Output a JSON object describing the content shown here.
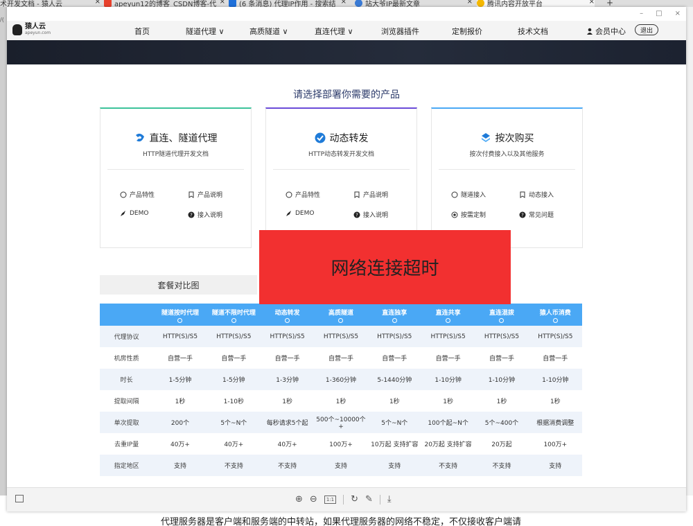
{
  "browser": {
    "tabs": [
      {
        "label": "术开发文档 - 猿人云",
        "active": false
      },
      {
        "label": "apeyun12的博客_CSDN博客-代",
        "active": false,
        "icon_color": "#e8412c"
      },
      {
        "label": "(6 条消息) 代理IP作用 - 搜索结",
        "active": false,
        "icon_color": "#1e6fd9"
      },
      {
        "label": "站大爷IP最新文章",
        "active": false,
        "icon_color": "#3a7bd5"
      },
      {
        "label": "腾讯内容开放平台",
        "active": true,
        "icon_color": "#f5b800"
      }
    ],
    "new_tab": "+",
    "left_stub": "/("
  },
  "window_controls": {
    "minimize": "–",
    "maximize": "□",
    "close": "×"
  },
  "site": {
    "logo": {
      "name": "猿人云",
      "domain": "apeyun.com"
    },
    "nav": [
      "首页",
      "隧道代理 ∨",
      "高质隧道 ∨",
      "直连代理 ∨",
      "浏览器插件",
      "定制报价",
      "技术文档"
    ],
    "user": "会员中心",
    "logout": "退出"
  },
  "section_title": "请选择部署你需要的产品",
  "cards": [
    {
      "title": "直连、隧道代理",
      "subtitle": "HTTP隧道代理开发文档",
      "accent": "#3cc29a",
      "icon": "arrow-logo-icon",
      "items": [
        "产品特性",
        "产品说明",
        "DEMO",
        "接入说明"
      ]
    },
    {
      "title": "动态转发",
      "subtitle": "HTTP动态转发开发文档",
      "accent": "#6a4bd8",
      "icon": "check-circle-icon",
      "items": [
        "产品特性",
        "产品说明",
        "DEMO",
        "接入说明"
      ]
    },
    {
      "title": "按次购买",
      "subtitle": "按次付费接入以及其他服务",
      "accent": "#4aa8f5",
      "icon": "layers-icon",
      "items": [
        "隧道接入",
        "动态接入",
        "按需定制",
        "常见问题"
      ]
    }
  ],
  "compare_tab": "套餐对比图",
  "overlay_message": "网络连接超时",
  "table": {
    "headers": [
      "",
      "隧道按时代理",
      "隧道不限时代理",
      "动态转发",
      "高质隧道",
      "直连独享",
      "直连共享",
      "直连混拨",
      "猿人币消费"
    ],
    "rows": [
      [
        "代理协议",
        "HTTP(S)/S5",
        "HTTP(S)/S5",
        "HTTP(S)/S5",
        "HTTP(S)/S5",
        "HTTP(S)/S5",
        "HTTP(S)/S5",
        "HTTP(S)/S5",
        "HTTP(S)/S5"
      ],
      [
        "机房性质",
        "自营一手",
        "自营一手",
        "自营一手",
        "自营一手",
        "自营一手",
        "自营一手",
        "自营一手",
        "自营一手"
      ],
      [
        "时长",
        "1-5分钟",
        "1-5分钟",
        "1-3分钟",
        "1-360分钟",
        "5-1440分钟",
        "1-10分钟",
        "1-10分钟",
        "1-10分钟"
      ],
      [
        "提取间隔",
        "1秒",
        "1-10秒",
        "1秒",
        "1秒",
        "1秒",
        "1秒",
        "1秒",
        "1秒"
      ],
      [
        "单次提取",
        "200个",
        "5个~N个",
        "每秒请求5个起",
        "500个~10000个+",
        "5个~N个",
        "100个起~N个",
        "5个~400个",
        "根据消费调整"
      ],
      [
        "去重IP量",
        "40万+",
        "40万+",
        "40万+",
        "100万+",
        "10万起 支持扩容",
        "20万起 支持扩容",
        "20万起",
        "100万+"
      ],
      [
        "指定地区",
        "支持",
        "不支持",
        "不支持",
        "支持",
        "支持",
        "不支持",
        "不支持",
        "支持"
      ]
    ]
  },
  "background_text": "代理服务器是客户端和服务端的中转站，如果代理服务器的网络不稳定，不仅接收客户端请"
}
